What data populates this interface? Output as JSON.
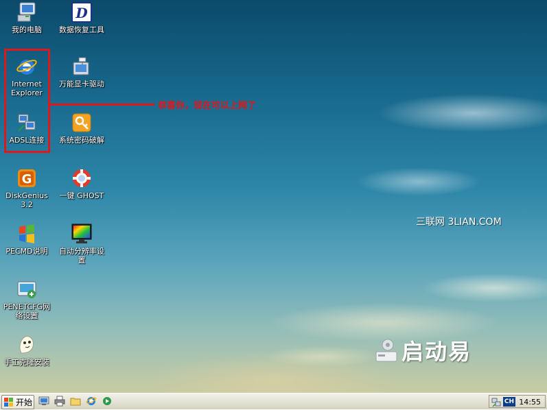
{
  "desktop": {
    "icons": [
      {
        "label": "我的电脑",
        "icon": "my-computer-icon"
      },
      {
        "label": "数据恢复工具",
        "icon": "data-recovery-icon"
      },
      {
        "label": "Internet Explorer",
        "icon": "internet-explorer-icon"
      },
      {
        "label": "万能显卡驱动",
        "icon": "display-driver-icon"
      },
      {
        "label": "ADSL连接",
        "icon": "adsl-connection-icon"
      },
      {
        "label": "系统密码破解",
        "icon": "password-crack-icon"
      },
      {
        "label": "DiskGenius 3.2",
        "icon": "diskgenius-icon"
      },
      {
        "label": "一键 GHOST",
        "icon": "ghost-icon"
      },
      {
        "label": "PECMD说明",
        "icon": "pecmd-icon"
      },
      {
        "label": "自动分辨率设置",
        "icon": "resolution-icon"
      },
      {
        "label": "PENETCFG网络设置",
        "icon": "network-config-icon"
      },
      {
        "label": "手工克隆安装",
        "icon": "clone-install-icon"
      }
    ],
    "callout": "恭喜你，现在可以上网了",
    "watermark": "三联网 3LIAN.COM",
    "brand": "启动易"
  },
  "taskbar": {
    "start_label": "开始",
    "quick_launch": [
      "desktop-icon",
      "printer-icon",
      "folder-icon",
      "internet-explorer-icon",
      "media-icon"
    ],
    "language": "CH",
    "clock": "14:55"
  },
  "colors": {
    "annotation_red": "#e0161b"
  }
}
